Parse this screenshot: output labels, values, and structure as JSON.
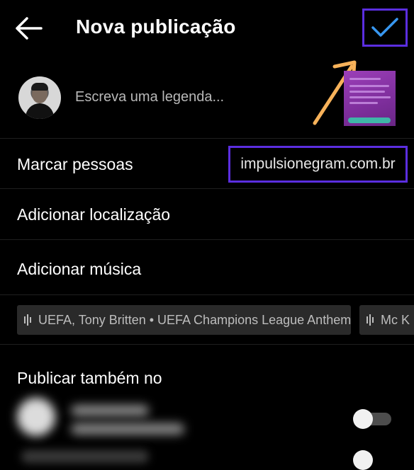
{
  "header": {
    "title": "Nova publicação"
  },
  "caption": {
    "placeholder": "Escreva uma legenda..."
  },
  "options": {
    "tag_people": "Marcar pessoas",
    "watermark": "impulsionegram.com.br",
    "add_location": "Adicionar localização",
    "add_music": "Adicionar música"
  },
  "music_suggestions": [
    "UEFA, Tony Britten • UEFA Champions League Anthem",
    "Mc K"
  ],
  "share": {
    "title": "Publicar também no",
    "accounts": [
      {
        "toggle_on": false
      },
      {
        "toggle_on": false
      }
    ]
  },
  "colors": {
    "background": "#000000",
    "accent_blue": "#3897f0",
    "highlight_box": "#5b2ee0",
    "annotation_arrow": "#f7b25a"
  }
}
